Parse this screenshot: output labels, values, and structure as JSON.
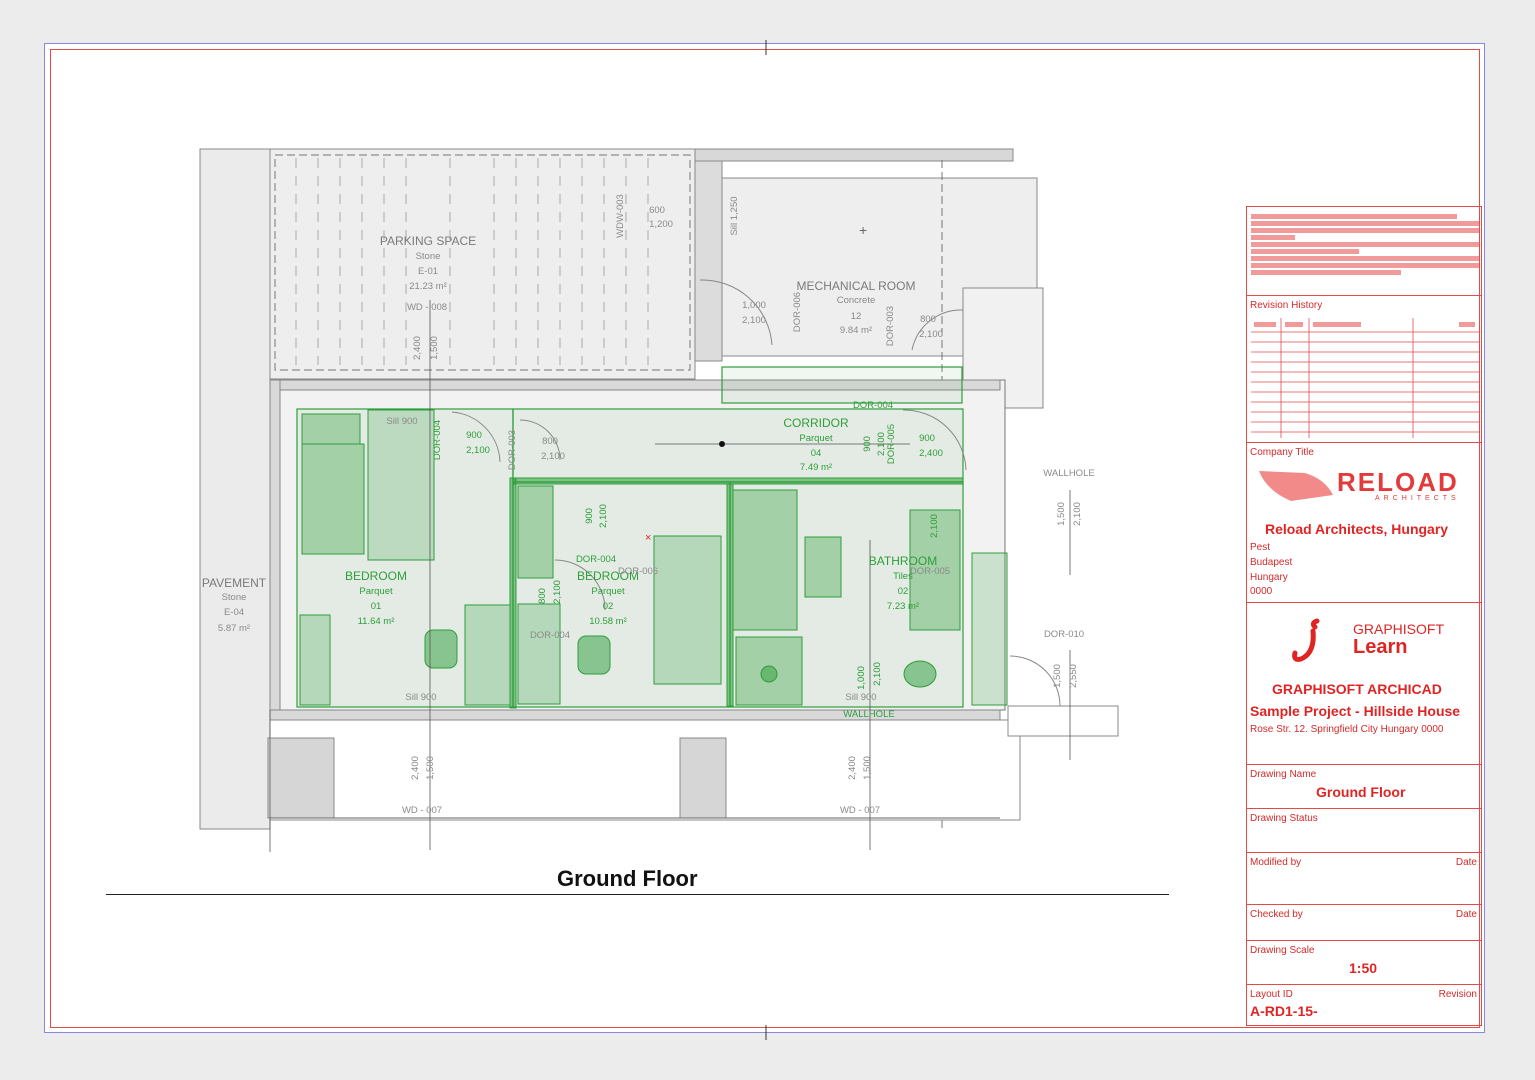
{
  "drawing": {
    "caption": "Ground Floor",
    "rooms": [
      {
        "name": "PARKING SPACE",
        "material": "Stone",
        "code": "E-01",
        "area": "21.23 m²"
      },
      {
        "name": "MECHANICAL ROOM",
        "material": "Concrete",
        "code": "12",
        "area": "9.84 m²"
      },
      {
        "name": "CORRIDOR",
        "material": "Parquet",
        "code": "04",
        "area": "7.49 m²"
      },
      {
        "name": "BEDROOM",
        "material": "Parquet",
        "code": "01",
        "area": "11.64 m²"
      },
      {
        "name": "BEDROOM",
        "material": "Parquet",
        "code": "02",
        "area": "10.58 m²"
      },
      {
        "name": "BATHROOM",
        "material": "Tiles",
        "code": "02",
        "area": "7.23 m²"
      },
      {
        "name": "PAVEMENT",
        "material": "Stone",
        "code": "E-04",
        "area": "5.87 m²"
      }
    ],
    "tags": {
      "wd008": "WD - 008",
      "wd007": "WD - 007",
      "wdw003": "WDW-003",
      "dor006": "DOR-006",
      "dor003": "DOR-003",
      "dor004": "DOR-004",
      "dor005": "DOR-005",
      "dor010": "DOR-010",
      "wallhole": "WALLHOLE",
      "sill900": "Sill 900",
      "sill1250": "Sill 1,250"
    },
    "dims": {
      "d600": "600",
      "d1200": "1,200",
      "d1000": "1,000",
      "d2100": "2,100",
      "d800": "800",
      "d900": "900",
      "d2400": "2,400",
      "d1500": "1,500",
      "d2550": "2,550"
    }
  },
  "titleblock": {
    "revision_history": "Revision History",
    "company_title_label": "Company Title",
    "logo_text": "RELOAD",
    "logo_sub": "ARCHITECTS",
    "company_name": "Reload Architects, Hungary",
    "address": [
      "Pest",
      "Budapest",
      "Hungary",
      "0000"
    ],
    "graphisoft_line1": "GRAPHISOFT",
    "graphisoft_line2": "Learn",
    "product": "GRAPHISOFT ARCHICAD",
    "project": "Sample Project - Hillside House",
    "project_address": "Rose Str. 12. Springfield City Hungary 0000",
    "drawing_name_label": "Drawing Name",
    "drawing_name": "Ground Floor",
    "drawing_status_label": "Drawing Status",
    "modified_by_label": "Modified by",
    "date_label": "Date",
    "checked_by_label": "Checked by",
    "drawing_scale_label": "Drawing Scale",
    "drawing_scale": "1:50",
    "layout_id_label": "Layout ID",
    "revision_label": "Revision",
    "layout_id": "A-RD1-15-"
  },
  "colors": {
    "green": "#2e9e3a",
    "red": "#e02424",
    "grey": "#8a8a8a",
    "frame": "#8b86e0"
  }
}
